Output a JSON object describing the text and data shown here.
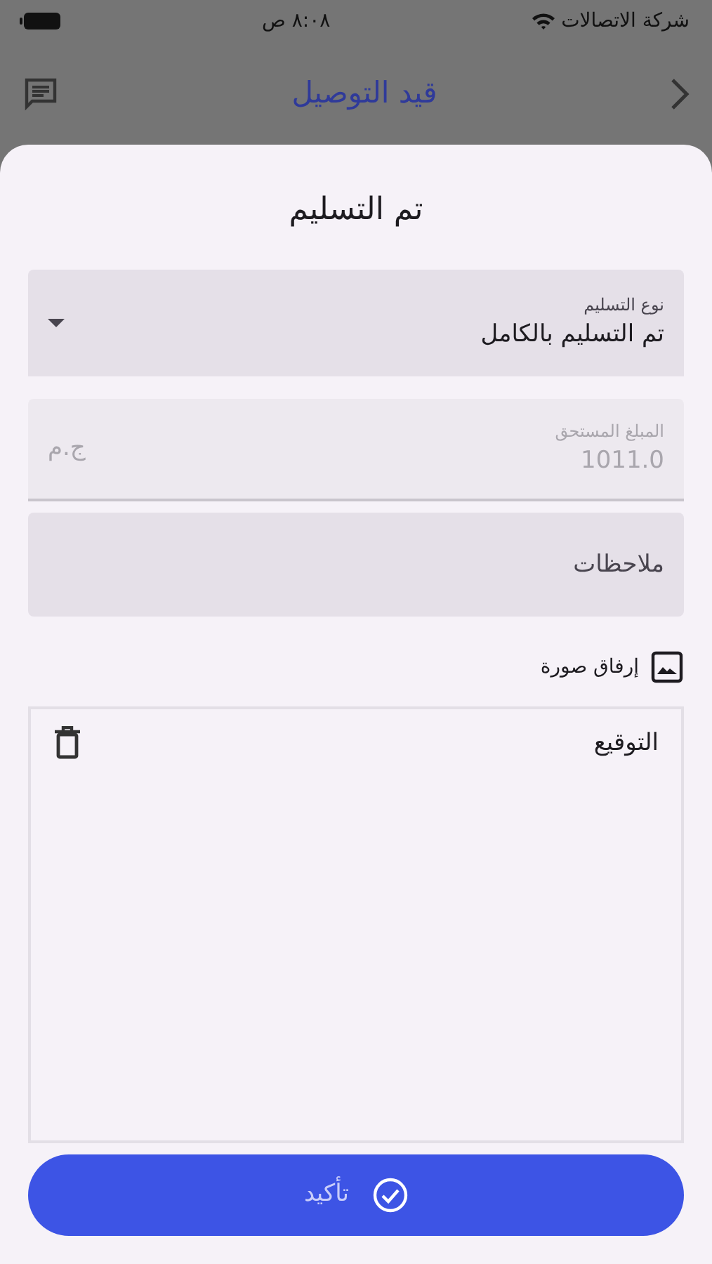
{
  "status_bar": {
    "carrier": "شركة الاتصالات",
    "time": "٨:٠٨ ص"
  },
  "header": {
    "title": "قيد التوصيل"
  },
  "sheet": {
    "title": "تم التسليم",
    "delivery_type": {
      "label": "نوع التسليم",
      "value": "تم التسليم بالكامل"
    },
    "amount_due": {
      "label": "المبلغ المستحق",
      "value": "1011.0",
      "suffix": "ج.م",
      "disabled": true
    },
    "notes": {
      "placeholder": "ملاحظات"
    },
    "attach_photo": {
      "label": "إرفاق صورة"
    },
    "signature": {
      "label": "التوقيع"
    },
    "confirm_button": {
      "label": "تأكيد"
    }
  }
}
